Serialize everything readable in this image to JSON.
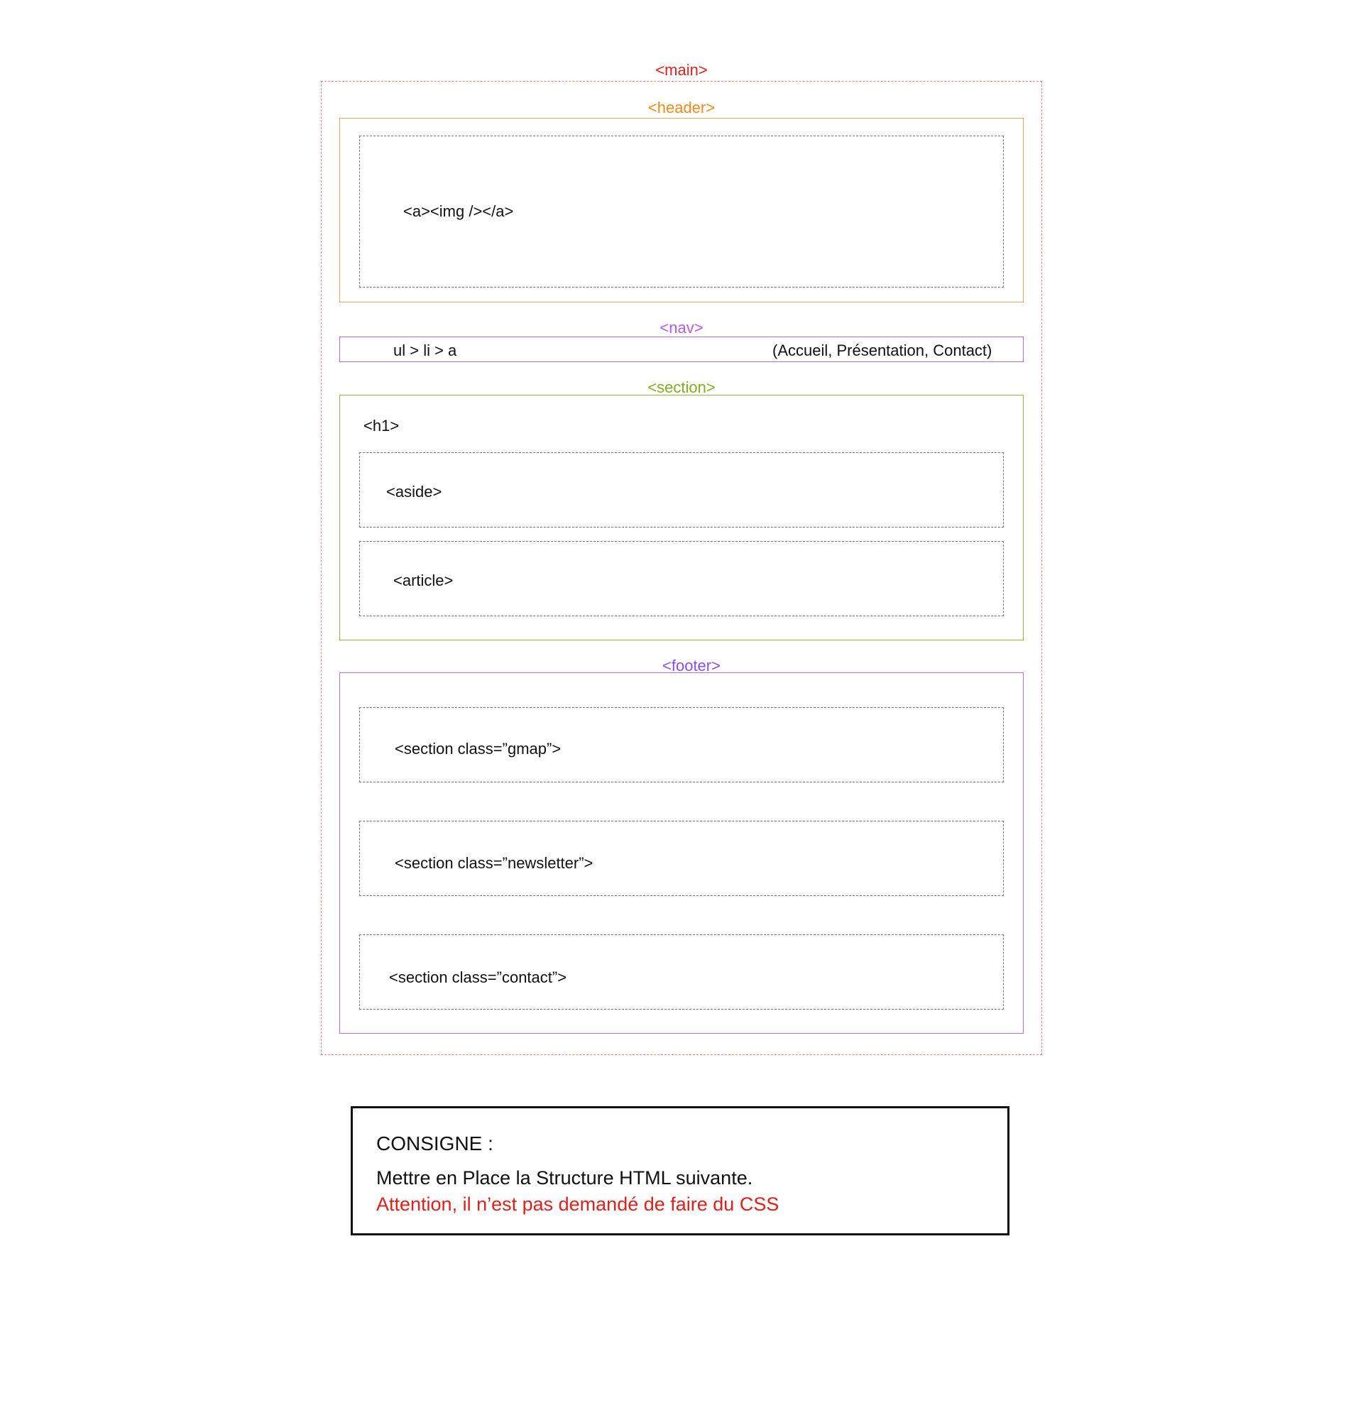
{
  "colors": {
    "main": "#e0201a",
    "header": "#f08a1c",
    "nav": "#b55be8",
    "section": "#7fae1e",
    "footer": "#8a4ff0",
    "dashed_inner": "#777777",
    "attention": "#e0201a"
  },
  "labels": {
    "main": "<main>",
    "header": "<header>",
    "nav": "<nav>",
    "section": "<section>",
    "footer": "<footer>"
  },
  "header": {
    "content": "<a><img /></a>"
  },
  "nav": {
    "structure": "ul > li > a",
    "items": "(Accueil, Présentation, Contact)"
  },
  "section": {
    "h1": "<h1>",
    "aside": "<aside>",
    "article": "<article>"
  },
  "footer": {
    "gmap": "<section class=”gmap”>",
    "newsletter": "<section class=”newsletter”>",
    "contact": "<section class=”contact”>"
  },
  "consigne": {
    "title": "CONSIGNE :",
    "instruction": "Mettre en Place la Structure HTML suivante.",
    "warning": "Attention, il n’est pas demandé de faire du CSS"
  }
}
